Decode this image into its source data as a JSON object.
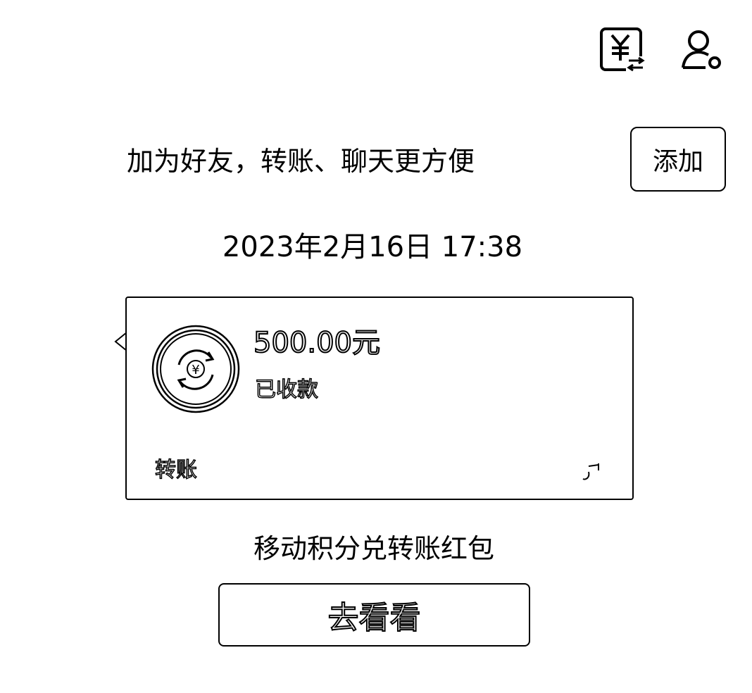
{
  "header": {
    "icons": [
      "transfer-yuan-icon",
      "profile-settings-icon"
    ]
  },
  "add_friend": {
    "text": "加为好友，转账、聊天更方便",
    "button_label": "添加"
  },
  "timestamp": "2023年2月16日 17:38",
  "transfer_card": {
    "amount": "500.00元",
    "status": "已收款",
    "footer_label": "转账",
    "icons": [
      "coin-transfer-icon",
      "app-logo-icon"
    ]
  },
  "promo": {
    "text": "移动积分兑转账红包",
    "button_label": "去看看"
  },
  "colors": {
    "background": "#ffffff",
    "foreground": "#000000"
  }
}
